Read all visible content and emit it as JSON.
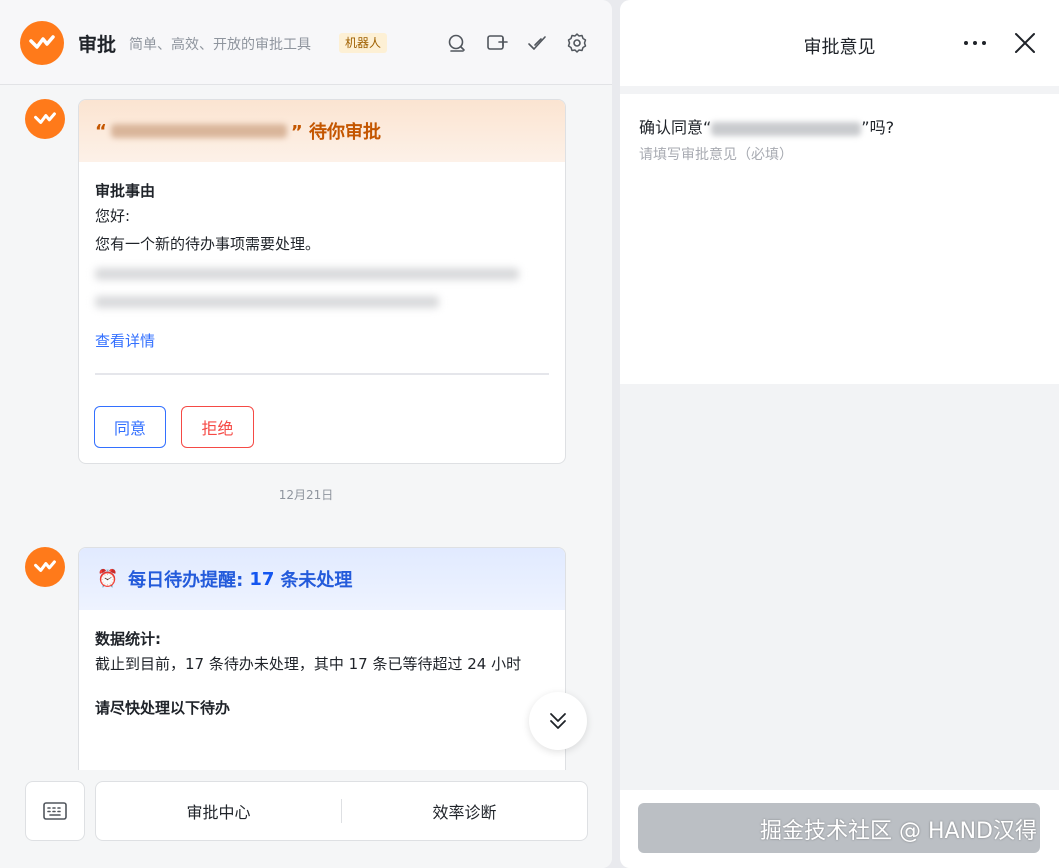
{
  "header": {
    "title": "审批",
    "subtitle": "简单、高效、开放的审批工具",
    "badge": "机器人",
    "icons": [
      "search-icon",
      "add-box-icon",
      "approve-check-icon",
      "settings-gear-icon"
    ]
  },
  "card1": {
    "title_prefix": "“",
    "title_suffix": "” 待你审批",
    "section_title": "审批事由",
    "greeting": "您好:",
    "body": "您有一个新的待办事项需要处理。",
    "link": "查看详情",
    "agree_label": "同意",
    "reject_label": "拒绝"
  },
  "date_separator": "12月21日",
  "card2": {
    "title_before": "每日待办提醒:",
    "count": "17",
    "title_after": "条未处理",
    "stats_title": "数据统计:",
    "stats_body": "截止到目前，17 条待办未处理，其中 17 条已等待超过 24 小时",
    "todo_title": "请尽快处理以下待办"
  },
  "bottom_menu": {
    "items": [
      "审批中心",
      "效率诊断"
    ]
  },
  "right_panel": {
    "title": "审批意见",
    "confirm_prefix": "确认同意“",
    "confirm_suffix": "”吗?",
    "opinion_placeholder": "请填写审批意见（必填）",
    "watermark": "掘金技术社区 @ HAND汉得"
  },
  "colors": {
    "brand_orange": "#ff7a1a",
    "primary_blue": "#3370ff",
    "danger_red": "#f54a45"
  }
}
